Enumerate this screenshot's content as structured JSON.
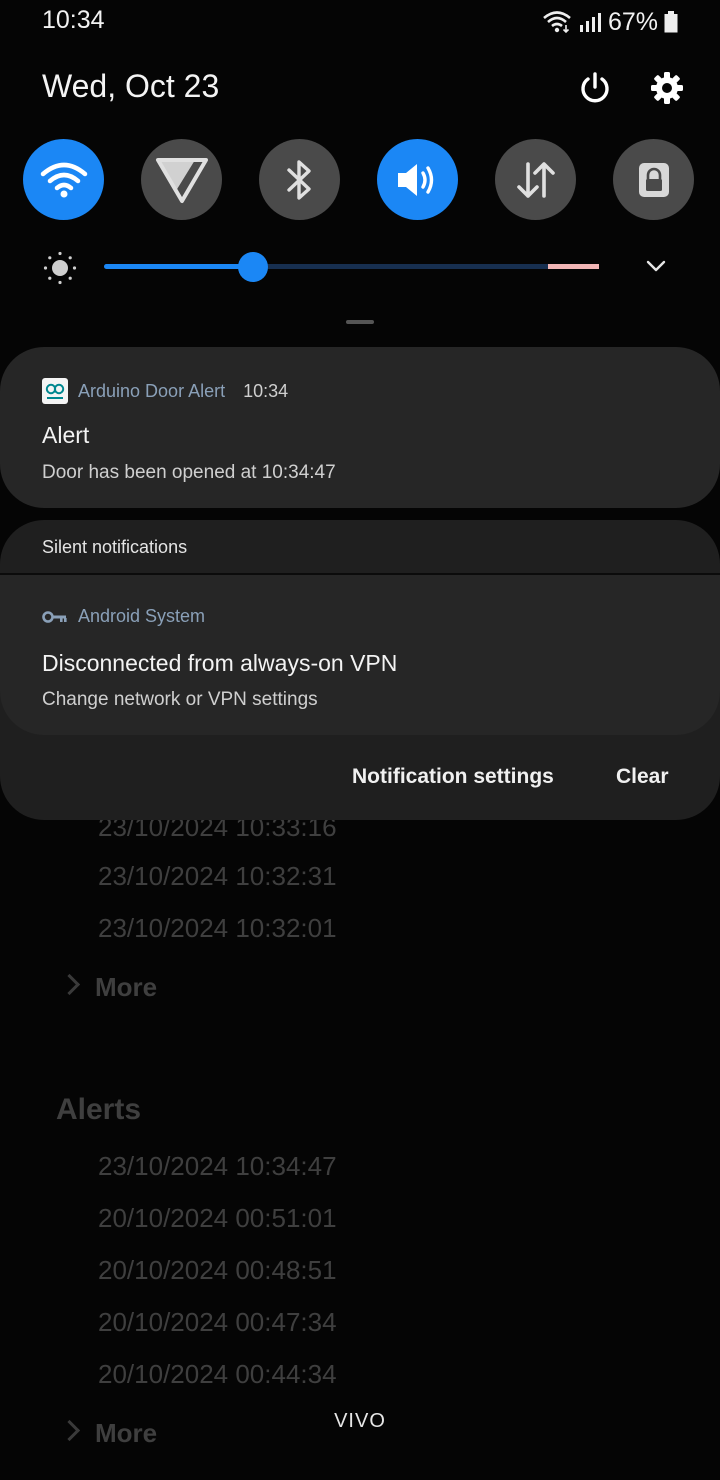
{
  "status_bar": {
    "time": "10:34",
    "battery": "67%"
  },
  "header": {
    "date": "Wed, Oct 23",
    "power_icon": "power-icon",
    "settings_icon": "gear-icon"
  },
  "quick_settings": [
    {
      "name": "wifi",
      "icon": "wifi-icon",
      "state": "on"
    },
    {
      "name": "vpn",
      "icon": "vpn-triangle-icon",
      "state": "off"
    },
    {
      "name": "bluetooth",
      "icon": "bluetooth-icon",
      "state": "off"
    },
    {
      "name": "sound",
      "icon": "speaker-icon",
      "state": "on"
    },
    {
      "name": "mobile-data",
      "icon": "data-arrows-icon",
      "state": "off"
    },
    {
      "name": "screen-lock",
      "icon": "lock-icon",
      "state": "off"
    }
  ],
  "brightness": {
    "level": 0.3
  },
  "notifications": {
    "arduino": {
      "app": "Arduino Door Alert",
      "time": "10:34",
      "title": "Alert",
      "body": "Door has been opened at 10:34:47"
    },
    "silent_label": "Silent notifications",
    "android": {
      "app": "Android System",
      "title": "Disconnected from always-on VPN",
      "body": "Change network or VPN settings"
    },
    "actions": {
      "settings": "Notification settings",
      "clear": "Clear"
    }
  },
  "background_app": {
    "list1": [
      "23/10/2024 10:33:16",
      "23/10/2024 10:32:31",
      "23/10/2024 10:32:01"
    ],
    "more1": "More",
    "alerts_heading": "Alerts",
    "list2": [
      "23/10/2024 10:34:47",
      "20/10/2024 00:51:01",
      "20/10/2024 00:48:51",
      "20/10/2024 00:47:34",
      "20/10/2024 00:44:34"
    ],
    "more2": "More"
  },
  "carrier_label": "VIVO",
  "colors": {
    "accent": "#1b87f5",
    "tile_off": "#4a4a4a",
    "card": "#262626"
  }
}
